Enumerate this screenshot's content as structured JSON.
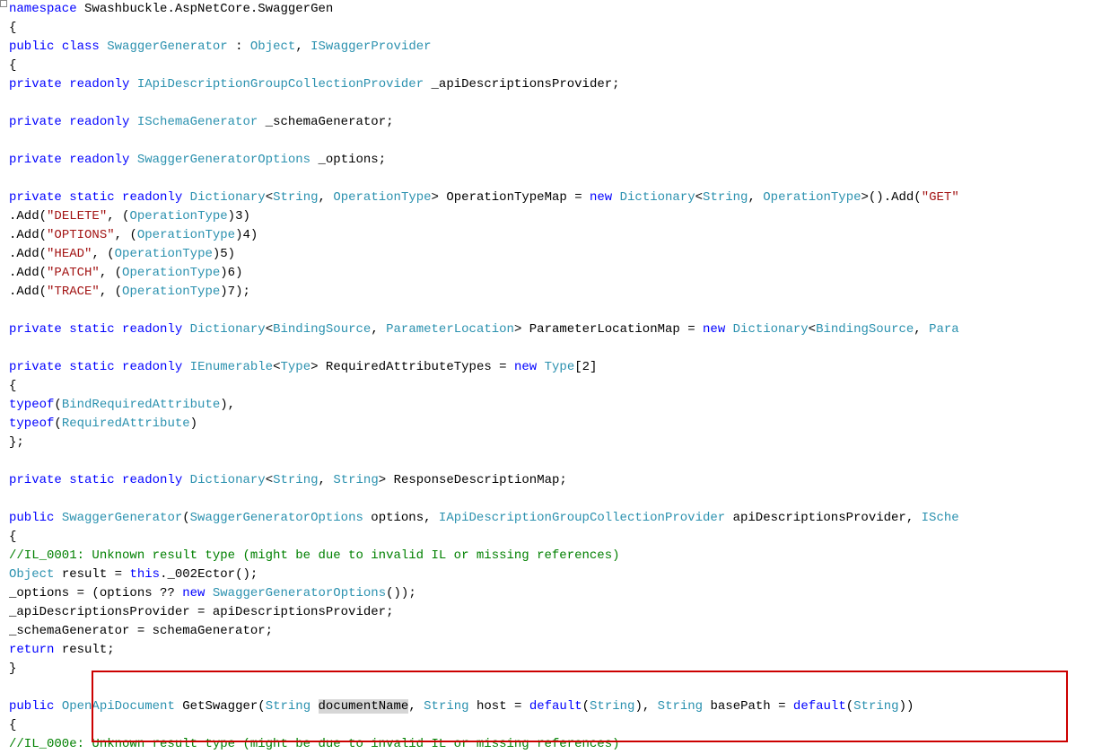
{
  "ns": {
    "kw": "namespace",
    "name": "Swashbuckle.AspNetCore.SwaggerGen"
  },
  "cls": {
    "mod": "public",
    "kw": "class",
    "name": "SwaggerGenerator",
    "sep": ":",
    "base": "Object",
    "iface": "ISwaggerProvider"
  },
  "f1": {
    "mod1": "private",
    "mod2": "readonly",
    "type": "IApiDescriptionGroupCollectionProvider",
    "name": "_apiDescriptionsProvider;"
  },
  "f2": {
    "mod1": "private",
    "mod2": "readonly",
    "type": "ISchemaGenerator",
    "name": "_schemaGenerator;"
  },
  "f3": {
    "mod1": "private",
    "mod2": "readonly",
    "type": "SwaggerGeneratorOptions",
    "name": "_options;"
  },
  "f4": {
    "mod1": "private",
    "mod2": "static",
    "mod3": "readonly",
    "type": "Dictionary",
    "tk": "String",
    "tv": "OperationType",
    "name": "OperationTypeMap",
    "eq": "=",
    "newkw": "new",
    "kget": "\"GET\""
  },
  "adds": [
    {
      "pre": ".Add(",
      "str": "\"DELETE\"",
      "mid": ", (",
      "cast": "OperationType",
      "post": ")3)"
    },
    {
      "pre": ".Add(",
      "str": "\"OPTIONS\"",
      "mid": ", (",
      "cast": "OperationType",
      "post": ")4)"
    },
    {
      "pre": ".Add(",
      "str": "\"HEAD\"",
      "mid": ", (",
      "cast": "OperationType",
      "post": ")5)"
    },
    {
      "pre": ".Add(",
      "str": "\"PATCH\"",
      "mid": ", (",
      "cast": "OperationType",
      "post": ")6)"
    },
    {
      "pre": ".Add(",
      "str": "\"TRACE\"",
      "mid": ", (",
      "cast": "OperationType",
      "post": ")7);"
    }
  ],
  "f5": {
    "mod1": "private",
    "mod2": "static",
    "mod3": "readonly",
    "type": "Dictionary",
    "tk": "BindingSource",
    "tv": "ParameterLocation",
    "name": "ParameterLocationMap",
    "eq": "=",
    "newkw": "new",
    "tk2": "BindingSource",
    "tv2": "Para"
  },
  "f6": {
    "mod1": "private",
    "mod2": "static",
    "mod3": "readonly",
    "type": "IEnumerable",
    "targ": "Type",
    "name": "RequiredAttributeTypes",
    "eq": "=",
    "newkw": "new",
    "arr": "[2]"
  },
  "typeof": {
    "kw": "typeof",
    "a1": "BindRequiredAttribute",
    "a2": "RequiredAttribute"
  },
  "f7": {
    "mod1": "private",
    "mod2": "static",
    "mod3": "readonly",
    "type": "Dictionary",
    "tk": "String",
    "tv": "String",
    "name": "ResponseDescriptionMap;"
  },
  "ctor": {
    "mod": "public",
    "name": "SwaggerGenerator",
    "p1t": "SwaggerGeneratorOptions",
    "p1n": "options,",
    "p2t": "IApiDescriptionGroupCollectionProvider",
    "p2n": "apiDescriptionsProvider,",
    "p3t": "ISche"
  },
  "ctorBody": {
    "c1": "//IL_0001: Unknown result type (might be due to invalid IL or missing references)",
    "l2a": "Object",
    "l2b": "result =",
    "l2c": "this",
    "l2d": "._002Ector();",
    "l3a": "_options = (options ??",
    "l3b": "new",
    "l3c": "SwaggerGeneratorOptions",
    "l3d": "());",
    "l4": "_apiDescriptionsProvider = apiDescriptionsProvider;",
    "l5": "_schemaGenerator = schemaGenerator;",
    "l6a": "return",
    "l6b": "result;"
  },
  "method": {
    "mod": "public",
    "ret": "OpenApiDocument",
    "name": "GetSwagger",
    "p1t": "String",
    "p1n": "documentName",
    "p2t": "String",
    "p2n": "host =",
    "p2d": "default",
    "p2dt": "String",
    "p3t": "String",
    "p3n": "basePath =",
    "p3d": "default",
    "p3dt": "String",
    "c1": "//IL_000e: Unknown result type (might be due to invalid IL or missing references)"
  },
  "colors": {
    "highlight": "#cc0000"
  }
}
